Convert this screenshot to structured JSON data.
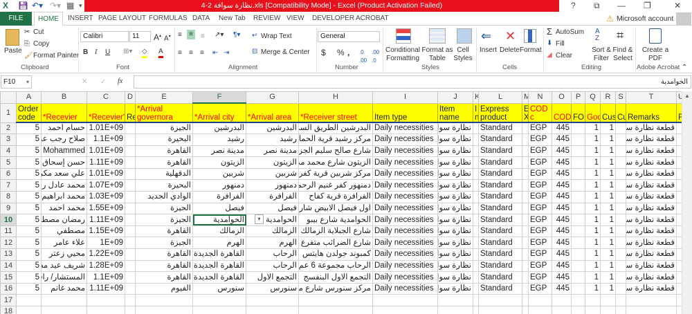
{
  "window": {
    "title": "4-2 نظارة سواقة.xls  [Compatibility Mode] -  Excel (Product Activation Failed)",
    "help": "?",
    "restore": "⧉",
    "minimize": "—",
    "maximize": "❐",
    "close": "✕",
    "title_color": "#e8101a"
  },
  "tabs": [
    "FILE",
    "HOME",
    "INSERT",
    "PAGE LAYOUT",
    "FORMULAS",
    "DATA",
    "New Tab",
    "REVIEW",
    "VIEW",
    "DEVELOPER",
    "ACROBAT"
  ],
  "account": {
    "label": "Microsoft account",
    "warning_icon": "warning-icon"
  },
  "ribbon": {
    "clipboard": {
      "paste": "Paste",
      "cut": "Cut",
      "copy": "Copy",
      "format_painter": "Format Painter",
      "label": "Clipboard"
    },
    "font": {
      "name": "Calibri",
      "size": "11",
      "bold": "B",
      "italic": "I",
      "underline": "U",
      "label": "Font"
    },
    "alignment": {
      "wrap": "Wrap Text",
      "merge": "Merge & Center",
      "label": "Alignment"
    },
    "number": {
      "format": "General",
      "currency": "$",
      "percent": "%",
      "comma": ",",
      "label": "Number"
    },
    "styles": {
      "conditional": "Conditional Formatting",
      "format_table": "Format as Table",
      "cell_styles": "Cell Styles",
      "label": "Styles"
    },
    "cells": {
      "insert": "Insert",
      "delete": "Delete",
      "format": "Format",
      "label": "Cells"
    },
    "editing": {
      "autosum": "AutoSum",
      "fill": "Fill",
      "clear": "Clear",
      "sort": "Sort & Filter",
      "find": "Find & Select",
      "label": "Editing"
    },
    "acrobat": {
      "create": "Create a PDF",
      "label": "Adobe Acrobat"
    }
  },
  "formula_bar": {
    "name_box": "F10",
    "fx": "fx",
    "value": "الحوامدية"
  },
  "sheet": {
    "columns": [
      "A",
      "B",
      "C",
      "D",
      "E",
      "F",
      "G",
      "H",
      "I",
      "J",
      "K",
      "L",
      "M",
      "N",
      "O",
      "P",
      "Q",
      "R",
      "S",
      "T",
      "U"
    ],
    "selected_column": "F",
    "selected_row": 10,
    "headers": [
      {
        "text": "Order code",
        "red": false
      },
      {
        "text": "*Recevier",
        "red": true
      },
      {
        "text": "*Recevier's",
        "red": true
      },
      {
        "text": "Re",
        "red": false
      },
      {
        "text": "*Arrival governora",
        "red": true
      },
      {
        "text": "*Arrival city",
        "red": true
      },
      {
        "text": "*Arrival area",
        "red": true
      },
      {
        "text": "*Receiver street",
        "red": true
      },
      {
        "text": "Item type",
        "red": false
      },
      {
        "text": "Item name",
        "red": false
      },
      {
        "text": "I n",
        "red": false
      },
      {
        "text": "Express product",
        "red": false
      },
      {
        "text": "E X",
        "red": false
      },
      {
        "text": "COD c",
        "red": true
      },
      {
        "text": "COD",
        "red": true
      },
      {
        "text": "FOI",
        "red": false
      },
      {
        "text": "Goo",
        "red": true
      },
      {
        "text": "Cust",
        "red": false
      },
      {
        "text": "Cu",
        "red": false
      },
      {
        "text": "Remarks",
        "red": false
      },
      {
        "text": "F",
        "red": false
      }
    ],
    "rows": [
      [
        "5",
        "حسام احمد",
        "1.01E+09",
        "",
        "الجيزة",
        "البدرشين",
        "البدرشين",
        "البدرشين الطريق السريع"
      ],
      [
        "5",
        "صلاح رجب عبود",
        "1.1E+09",
        "",
        "البحيرة",
        "رشيد",
        "رشيد",
        "مركز رشيد قرية الحماد"
      ],
      [
        "5",
        "Mohammed",
        "1.01E+09",
        "",
        "القاهرة",
        "مدينة نصر",
        "مدينة نصر",
        "شارع صالح سليم الجزء"
      ],
      [
        "5",
        "حسن إسحاق حا",
        "1.11E+09",
        "",
        "القاهرة",
        "الزيتون",
        "الزيتون",
        "الزيتون شارع محمد مد"
      ],
      [
        "5",
        "علي سعد مكروم",
        "1.01E+09",
        "",
        "الدقهلية",
        "شربين",
        "شربين",
        "مركز شربين قرية كفر الا"
      ],
      [
        "5",
        "محمد عادل رشا",
        "1.07E+09",
        "",
        "البحيرة",
        "دمنهور",
        "دمنهور",
        "دمنهور كفر غنيم الرحم"
      ],
      [
        "5",
        "محمد ابراهيم",
        "1.03E+09",
        "",
        "الوادي الجديد",
        "الفرافرة",
        "الفرافرة",
        "الفرافرة قرية كفاح"
      ],
      [
        "5",
        "محمد احمد",
        "1.55E+09",
        "",
        "الجيزة",
        "فيصل",
        "فيصل",
        "اول فيصل الابيض شار"
      ],
      [
        "5",
        "رمضان مصطفى",
        "1.11E+09",
        "",
        "الجيزة",
        "الحوامدية",
        "الحوامدية",
        "الحوامدية شارع بيبو"
      ],
      [
        "5",
        "مصطفي",
        "1.15E+09",
        "",
        "القاهرة",
        "الزمالك",
        "الزمالك",
        "شارع الجبلاية الزمالك"
      ],
      [
        "5",
        "علاء عامر",
        "1E+09",
        "",
        "الجيزة",
        "الهرم",
        "الهرم",
        "شارع الضرائب متفرع م"
      ],
      [
        "5",
        "محيي زعتر",
        "1.22E+09",
        "",
        "القاهرة",
        "القاهرة الجديدة",
        "الرحاب",
        "كمبوند جولدن هايتس"
      ],
      [
        "5",
        "شريف عيد مصد",
        "1.28E+09",
        "",
        "القاهرة",
        "القاهرة الجديدة",
        "الرحاب",
        "الرحاب مجموعة 6 عم"
      ],
      [
        "5",
        "المستشار/ رافت",
        "1.1E+09",
        "",
        "القاهرة",
        "القاهرة الجديدة",
        "التجمع الاول",
        "التجمع الاول البنفسج"
      ],
      [
        "5",
        "محمد غانم",
        "1.11E+09",
        "",
        "الفيوم",
        "سنورس",
        "سنورس",
        "مركز سنورس شارع مج"
      ]
    ],
    "common": {
      "item_type": "Daily necessities",
      "item_name": "نظارة سواقة",
      "express": "Standard",
      "currency": "EGP",
      "cod": "445",
      "goods": "1",
      "cust": "1",
      "remarks": "قطعة نظارة سواقة"
    },
    "empty_rows": [
      17,
      18
    ]
  }
}
